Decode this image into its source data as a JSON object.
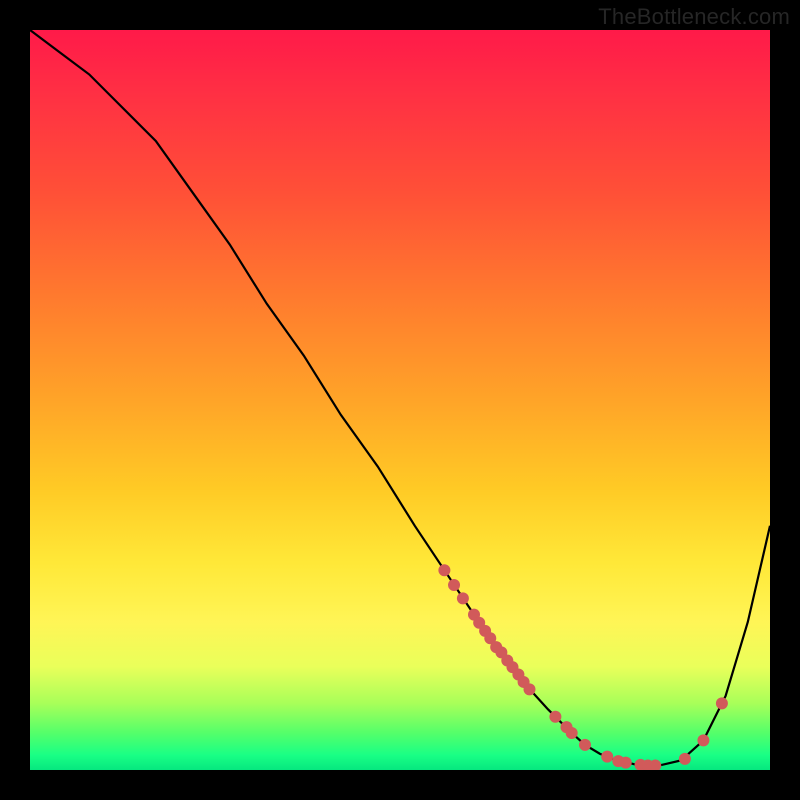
{
  "watermark": "TheBottleneck.com",
  "colors": {
    "curve": "#000000",
    "marker": "#d15a5a",
    "gradient_top": "#ff1a49",
    "gradient_bottom": "#06e77f"
  },
  "chart_data": {
    "type": "line",
    "title": "",
    "xlabel": "",
    "ylabel": "",
    "xlim": [
      0,
      100
    ],
    "ylim": [
      0,
      100
    ],
    "grid": false,
    "legend": false,
    "series": [
      {
        "name": "curve",
        "x": [
          0,
          4,
          8,
          12,
          17,
          22,
          27,
          32,
          37,
          42,
          47,
          52,
          56,
          60,
          64,
          67,
          70,
          73,
          75,
          77,
          79,
          82,
          85,
          88,
          91,
          94,
          97,
          100
        ],
        "values": [
          100,
          97,
          94,
          90,
          85,
          78,
          71,
          63,
          56,
          48,
          41,
          33,
          27,
          21,
          15.5,
          11.5,
          8.2,
          5.2,
          3.4,
          2.2,
          1.4,
          0.7,
          0.6,
          1.3,
          4,
          10,
          20,
          33
        ]
      }
    ],
    "markers": [
      {
        "x": 56.0,
        "y": 27.0
      },
      {
        "x": 57.3,
        "y": 25.0
      },
      {
        "x": 58.5,
        "y": 23.2
      },
      {
        "x": 60.0,
        "y": 21.0
      },
      {
        "x": 60.7,
        "y": 19.9
      },
      {
        "x": 61.5,
        "y": 18.8
      },
      {
        "x": 62.2,
        "y": 17.8
      },
      {
        "x": 63.0,
        "y": 16.6
      },
      {
        "x": 63.7,
        "y": 15.9
      },
      {
        "x": 64.5,
        "y": 14.8
      },
      {
        "x": 65.2,
        "y": 13.9
      },
      {
        "x": 66.0,
        "y": 12.9
      },
      {
        "x": 66.7,
        "y": 11.9
      },
      {
        "x": 67.5,
        "y": 10.9
      },
      {
        "x": 71.0,
        "y": 7.2
      },
      {
        "x": 72.5,
        "y": 5.8
      },
      {
        "x": 73.2,
        "y": 5.0
      },
      {
        "x": 75.0,
        "y": 3.4
      },
      {
        "x": 78.0,
        "y": 1.8
      },
      {
        "x": 79.5,
        "y": 1.2
      },
      {
        "x": 80.5,
        "y": 1.0
      },
      {
        "x": 82.5,
        "y": 0.7
      },
      {
        "x": 83.5,
        "y": 0.6
      },
      {
        "x": 84.5,
        "y": 0.6
      },
      {
        "x": 88.5,
        "y": 1.5
      },
      {
        "x": 91.0,
        "y": 4.0
      },
      {
        "x": 93.5,
        "y": 9.0
      }
    ]
  }
}
